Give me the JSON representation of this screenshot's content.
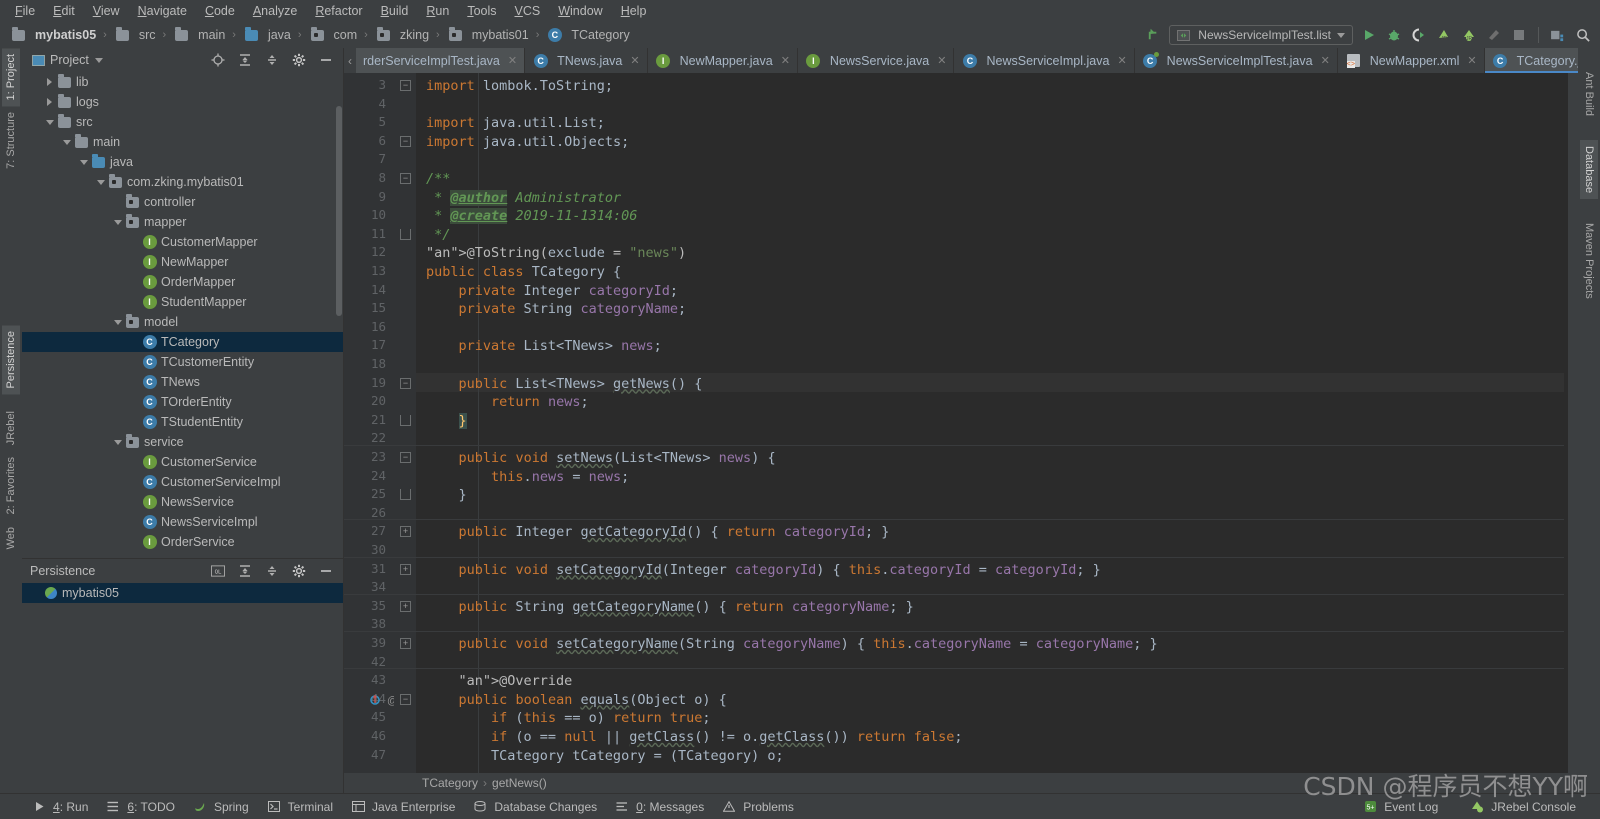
{
  "menu": {
    "items": [
      "File",
      "Edit",
      "View",
      "Navigate",
      "Code",
      "Analyze",
      "Refactor",
      "Build",
      "Run",
      "Tools",
      "VCS",
      "Window",
      "Help"
    ]
  },
  "navbar": {
    "crumbs": [
      {
        "label": "mybatis05",
        "icon": "module-icon"
      },
      {
        "label": "src",
        "icon": "folder-icon"
      },
      {
        "label": "main",
        "icon": "folder-icon"
      },
      {
        "label": "java",
        "icon": "source-folder-icon"
      },
      {
        "label": "com",
        "icon": "package-icon"
      },
      {
        "label": "zking",
        "icon": "package-icon"
      },
      {
        "label": "mybatis01",
        "icon": "package-icon"
      },
      {
        "label": "TCategory",
        "icon": "class-icon"
      }
    ],
    "run_config": "NewsServiceImplTest.list",
    "toolbar_icons": [
      "back-arrow-icon",
      "run-icon",
      "debug-icon",
      "run-with-coverage-icon",
      "run-junit-icon",
      "debug-junit-icon",
      "build-icon",
      "stop-icon",
      "project-structure-icon",
      "search-icon"
    ]
  },
  "left_strip": {
    "tabs": [
      {
        "label": "1: Project",
        "selected": true,
        "icon": "project-icon"
      },
      {
        "label": "7: Structure",
        "selected": false,
        "icon": "structure-icon"
      },
      {
        "label": "Persistence",
        "selected": true,
        "icon": "persistence-icon"
      },
      {
        "label": "JRebel",
        "selected": false,
        "icon": "jrebel-icon"
      },
      {
        "label": "2: Favorites",
        "selected": false,
        "icon": "star-icon"
      },
      {
        "label": "Web",
        "selected": false,
        "icon": "web-icon"
      }
    ]
  },
  "right_strip": {
    "tabs": [
      {
        "label": "Ant Build",
        "selected": false,
        "icon": "ant-icon"
      },
      {
        "label": "Database",
        "selected": true,
        "icon": "database-icon"
      },
      {
        "label": "Maven Projects",
        "selected": false,
        "icon": "maven-icon"
      }
    ]
  },
  "project_panel": {
    "title": "Project",
    "header_icons": [
      "locate-icon",
      "expand-all-icon",
      "collapse-all-icon",
      "gear-icon",
      "hide-icon"
    ],
    "tree": [
      {
        "label": "lib",
        "indent": 1,
        "twist": "right",
        "icon": "folder",
        "selected": false
      },
      {
        "label": "logs",
        "indent": 1,
        "twist": "right",
        "icon": "folder",
        "selected": false
      },
      {
        "label": "src",
        "indent": 1,
        "twist": "down",
        "icon": "folder",
        "selected": false
      },
      {
        "label": "main",
        "indent": 2,
        "twist": "down",
        "icon": "folder",
        "selected": false
      },
      {
        "label": "java",
        "indent": 3,
        "twist": "down",
        "icon": "folder-blue",
        "selected": false
      },
      {
        "label": "com.zking.mybatis01",
        "indent": 4,
        "twist": "down",
        "icon": "package",
        "selected": false
      },
      {
        "label": "controller",
        "indent": 5,
        "twist": "none",
        "icon": "package",
        "selected": false
      },
      {
        "label": "mapper",
        "indent": 5,
        "twist": "down",
        "icon": "package",
        "selected": false
      },
      {
        "label": "CustomerMapper",
        "indent": 6,
        "twist": "none",
        "icon": "interface",
        "selected": false
      },
      {
        "label": "NewMapper",
        "indent": 6,
        "twist": "none",
        "icon": "interface",
        "selected": false
      },
      {
        "label": "OrderMapper",
        "indent": 6,
        "twist": "none",
        "icon": "interface",
        "selected": false
      },
      {
        "label": "StudentMapper",
        "indent": 6,
        "twist": "none",
        "icon": "interface",
        "selected": false
      },
      {
        "label": "model",
        "indent": 5,
        "twist": "down",
        "icon": "package",
        "selected": false
      },
      {
        "label": "TCategory",
        "indent": 6,
        "twist": "none",
        "icon": "class",
        "selected": true
      },
      {
        "label": "TCustomerEntity",
        "indent": 6,
        "twist": "none",
        "icon": "class",
        "selected": false
      },
      {
        "label": "TNews",
        "indent": 6,
        "twist": "none",
        "icon": "class",
        "selected": false
      },
      {
        "label": "TOrderEntity",
        "indent": 6,
        "twist": "none",
        "icon": "class",
        "selected": false
      },
      {
        "label": "TStudentEntity",
        "indent": 6,
        "twist": "none",
        "icon": "class",
        "selected": false
      },
      {
        "label": "service",
        "indent": 5,
        "twist": "down",
        "icon": "package",
        "selected": false
      },
      {
        "label": "CustomerService",
        "indent": 6,
        "twist": "none",
        "icon": "interface",
        "selected": false
      },
      {
        "label": "CustomerServiceImpl",
        "indent": 6,
        "twist": "none",
        "icon": "class",
        "selected": false
      },
      {
        "label": "NewsService",
        "indent": 6,
        "twist": "none",
        "icon": "interface",
        "selected": false
      },
      {
        "label": "NewsServiceImpl",
        "indent": 6,
        "twist": "none",
        "icon": "class",
        "selected": false
      },
      {
        "label": "OrderService",
        "indent": 6,
        "twist": "none",
        "icon": "interface",
        "selected": false
      }
    ]
  },
  "persistence_panel": {
    "title": "Persistence",
    "header_icons": [
      "sql-icon",
      "expand-all-icon",
      "collapse-all-icon",
      "gear-icon",
      "hide-icon"
    ],
    "items": [
      {
        "label": "mybatis05",
        "icon": "datasource-icon",
        "selected": true
      }
    ]
  },
  "editor_tabs": [
    {
      "label": "rderServiceImplTest.java",
      "icon": "class-icon",
      "state": "clipped"
    },
    {
      "label": "TNews.java",
      "icon": "class-icon",
      "state": "normal"
    },
    {
      "label": "NewMapper.java",
      "icon": "interface-icon",
      "state": "normal"
    },
    {
      "label": "NewsService.java",
      "icon": "interface-icon",
      "state": "normal"
    },
    {
      "label": "NewsServiceImpl.java",
      "icon": "class-icon",
      "state": "normal"
    },
    {
      "label": "NewsServiceImplTest.java",
      "icon": "test-class-icon",
      "state": "normal"
    },
    {
      "label": "NewMapper.xml",
      "icon": "xml-icon",
      "state": "normal"
    },
    {
      "label": "TCategory.java",
      "icon": "class-icon",
      "state": "active"
    }
  ],
  "editor": {
    "lines": [
      {
        "num": "3",
        "fold": "minus",
        "text": "import lombok.ToString;"
      },
      {
        "num": "4",
        "fold": "none",
        "text": ""
      },
      {
        "num": "5",
        "fold": "none",
        "text": "import java.util.List;"
      },
      {
        "num": "6",
        "fold": "minus",
        "text": "import java.util.Objects;"
      },
      {
        "num": "7",
        "fold": "none",
        "text": ""
      },
      {
        "num": "8",
        "fold": "minus",
        "text": "/**"
      },
      {
        "num": "9",
        "fold": "none",
        "text": " * @author Administrator"
      },
      {
        "num": "10",
        "fold": "none",
        "text": " * @create 2019-11-1314:06"
      },
      {
        "num": "11",
        "fold": "end",
        "text": " */"
      },
      {
        "num": "12",
        "fold": "none",
        "text": "@ToString(exclude = \"news\")"
      },
      {
        "num": "13",
        "fold": "none",
        "text": "public class TCategory {"
      },
      {
        "num": "14",
        "fold": "none",
        "text": "    private Integer categoryId;"
      },
      {
        "num": "15",
        "fold": "none",
        "text": "    private String categoryName;"
      },
      {
        "num": "16",
        "fold": "none",
        "text": ""
      },
      {
        "num": "17",
        "fold": "none",
        "text": "    private List<TNews> news;"
      },
      {
        "num": "18",
        "fold": "none",
        "text": ""
      },
      {
        "num": "19",
        "fold": "minus",
        "text": "    public List<TNews> getNews() {"
      },
      {
        "num": "20",
        "fold": "none",
        "text": "        return news;"
      },
      {
        "num": "21",
        "fold": "end",
        "text": "    }"
      },
      {
        "num": "22",
        "fold": "none",
        "text": ""
      },
      {
        "num": "23",
        "fold": "minus",
        "text": "    public void setNews(List<TNews> news) {"
      },
      {
        "num": "24",
        "fold": "none",
        "text": "        this.news = news;"
      },
      {
        "num": "25",
        "fold": "end",
        "text": "    }"
      },
      {
        "num": "26",
        "fold": "none",
        "text": ""
      },
      {
        "num": "27",
        "fold": "plus",
        "text": "    public Integer getCategoryId() { return categoryId; }"
      },
      {
        "num": "30",
        "fold": "none",
        "text": ""
      },
      {
        "num": "31",
        "fold": "plus",
        "text": "    public void setCategoryId(Integer categoryId) { this.categoryId = categoryId; }"
      },
      {
        "num": "34",
        "fold": "none",
        "text": ""
      },
      {
        "num": "35",
        "fold": "plus",
        "text": "    public String getCategoryName() { return categoryName; }"
      },
      {
        "num": "38",
        "fold": "none",
        "text": ""
      },
      {
        "num": "39",
        "fold": "plus",
        "text": "    public void setCategoryName(String categoryName) { this.categoryName = categoryName; }"
      },
      {
        "num": "42",
        "fold": "none",
        "text": ""
      },
      {
        "num": "43",
        "fold": "none",
        "text": "    @Override"
      },
      {
        "num": "44",
        "fold": "minus",
        "text": "    public boolean equals(Object o) {"
      },
      {
        "num": "45",
        "fold": "none",
        "text": "        if (this == o) return true;"
      },
      {
        "num": "46",
        "fold": "none",
        "text": "        if (o == null || getClass() != o.getClass()) return false;"
      },
      {
        "num": "47",
        "fold": "none",
        "text": "        TCategory tCategory = (TCategory) o;"
      }
    ],
    "caret_line_index": 16,
    "gutter_markers": [
      {
        "line": "44",
        "icons": [
          "override-method-icon",
          "annotation-icon"
        ]
      }
    ],
    "breadcrumb": [
      "TCategory",
      "getNews()"
    ]
  },
  "bottom_bar": {
    "tools": [
      {
        "label": "4: Run",
        "icon": "run-icon",
        "mnemonic": "4"
      },
      {
        "label": "6: TODO",
        "icon": "todo-icon",
        "mnemonic": "6"
      },
      {
        "label": "Spring",
        "icon": "spring-icon",
        "mnemonic": ""
      },
      {
        "label": "Terminal",
        "icon": "terminal-icon",
        "mnemonic": ""
      },
      {
        "label": "Java Enterprise",
        "icon": "jee-icon",
        "mnemonic": ""
      },
      {
        "label": "Database Changes",
        "icon": "db-changes-icon",
        "mnemonic": ""
      },
      {
        "label": "0: Messages",
        "icon": "messages-icon",
        "mnemonic": "0"
      },
      {
        "label": "Problems",
        "icon": "problems-icon",
        "mnemonic": ""
      }
    ],
    "right_tools": [
      {
        "label": "Event Log",
        "icon": "event-log-icon"
      },
      {
        "label": "JRebel Console",
        "icon": "jrebel-icon"
      }
    ]
  },
  "watermark": "CSDN @程序员不想YY啊",
  "colors": {
    "panel_bg": "#3c3f41",
    "editor_bg": "#2b2b2b",
    "gutter_bg": "#313335",
    "selection_bg": "#0d293e",
    "tab_active_bg": "#4e5254",
    "accent_blue": "#4a88c7",
    "keyword": "#cc7832",
    "string": "#6a8759",
    "comment": "#629755",
    "field": "#9876aa",
    "annotation": "#bbb529",
    "text": "#a9b7c6"
  }
}
